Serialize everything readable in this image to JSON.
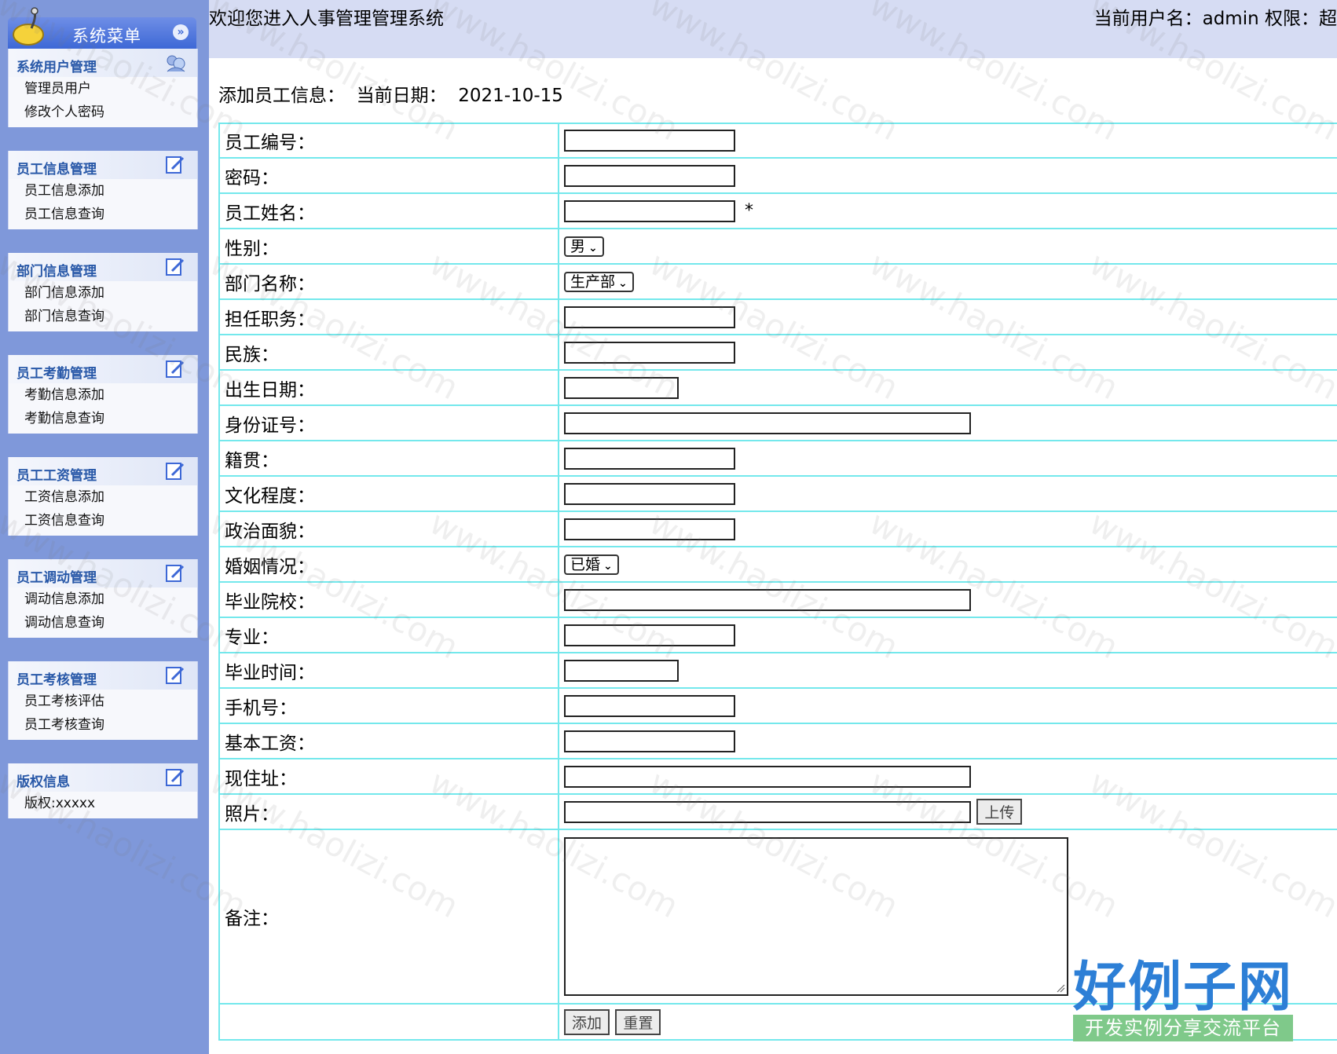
{
  "sidebar": {
    "title": "系统菜单",
    "panels": [
      {
        "title": "系统用户管理",
        "items": [
          "管理员用户",
          "修改个人密码"
        ]
      },
      {
        "title": "员工信息管理",
        "items": [
          "员工信息添加",
          "员工信息查询"
        ]
      },
      {
        "title": "部门信息管理",
        "items": [
          "部门信息添加",
          "部门信息查询"
        ]
      },
      {
        "title": "员工考勤管理",
        "items": [
          "考勤信息添加",
          "考勤信息查询"
        ]
      },
      {
        "title": "员工工资管理",
        "items": [
          "工资信息添加",
          "工资信息查询"
        ]
      },
      {
        "title": "员工调动管理",
        "items": [
          "调动信息添加",
          "调动信息查询"
        ]
      },
      {
        "title": "员工考核管理",
        "items": [
          "员工考核评估",
          "员工考核查询"
        ]
      },
      {
        "title": "版权信息",
        "items": [
          "版权:xxxxx"
        ]
      }
    ]
  },
  "header": {
    "welcome": "欢迎您进入人事管理管理系统",
    "user_info": "当前用户名：admin 权限：超"
  },
  "form": {
    "heading": "添加员工信息：  当前日期：  2021-10-15",
    "fields": {
      "emp_no": "员工编号：",
      "password": "密码：",
      "name": "员工姓名：",
      "required_mark": "*",
      "gender": "性别：",
      "gender_value": "男",
      "dept": "部门名称：",
      "dept_value": "生产部",
      "position": "担任职务：",
      "ethnicity": "民族：",
      "birthdate": "出生日期：",
      "id_card": "身份证号：",
      "native_place": "籍贯：",
      "education": "文化程度：",
      "political": "政治面貌：",
      "marital": "婚姻情况：",
      "marital_value": "已婚",
      "school": "毕业院校：",
      "major": "专业：",
      "grad_date": "毕业时间：",
      "phone": "手机号：",
      "salary": "基本工资：",
      "address": "现住址：",
      "photo": "照片：",
      "remark": "备注："
    },
    "upload_label": "上传",
    "add_label": "添加",
    "reset_label": "重置"
  },
  "brand": {
    "name": "好例子网",
    "tagline": "开发实例分享交流平台"
  },
  "watermark": "www.haolizi.com",
  "colors": {
    "sidebar_bg": "#7f98da",
    "topbar_bg": "#d6dcf3",
    "table_border": "#74e8ec",
    "panel_title": "#2858a8"
  }
}
